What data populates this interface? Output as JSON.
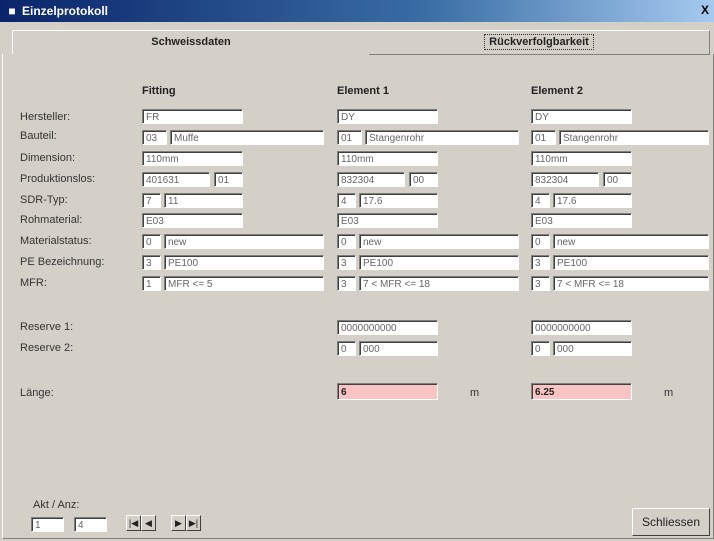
{
  "window": {
    "title": "Einzelprotokoll",
    "close_label": "X"
  },
  "tabs": [
    {
      "label": "Schweissdaten"
    },
    {
      "label": "Rückverfolgbarkeit"
    }
  ],
  "columns": {
    "fitting": "Fitting",
    "element1": "Element 1",
    "element2": "Element 2"
  },
  "labels": {
    "hersteller": "Hersteller:",
    "bauteil": "Bauteil:",
    "dimension": "Dimension:",
    "produktionslos": "Produktionslos:",
    "sdr_typ": "SDR-Typ:",
    "rohmaterial": "Rohmaterial:",
    "materialstatus": "Materialstatus:",
    "pe_bezeichnung": "PE Bezeichnung:",
    "mfr": "MFR:",
    "reserve1": "Reserve 1:",
    "reserve2": "Reserve 2:",
    "laenge": "Länge:"
  },
  "fitting": {
    "hersteller": "FR",
    "bauteil_code": "03",
    "bauteil_name": "Muffe",
    "dimension": "110mm",
    "prodlos1": "401631",
    "prodlos2": "01",
    "sdr1": "7",
    "sdr2": "11",
    "rohmaterial": "E03",
    "mat_code": "0",
    "mat_name": "new",
    "pe_code": "3",
    "pe_name": "PE100",
    "mfr_code": "1",
    "mfr_name": "MFR <= 5"
  },
  "element1": {
    "hersteller": "DY",
    "bauteil_code": "01",
    "bauteil_name": "Stangenrohr",
    "dimension": "110mm",
    "prodlos1": "832304",
    "prodlos2": "00",
    "sdr1": "4",
    "sdr2": "17.6",
    "rohmaterial": "E03",
    "mat_code": "0",
    "mat_name": "new",
    "pe_code": "3",
    "pe_name": "PE100",
    "mfr_code": "3",
    "mfr_name": "7 < MFR <= 18",
    "reserve1": "0000000000",
    "reserve2_code": "0",
    "reserve2_val": "000",
    "laenge": "6",
    "unit": "m"
  },
  "element2": {
    "hersteller": "DY",
    "bauteil_code": "01",
    "bauteil_name": "Stangenrohr",
    "dimension": "110mm",
    "prodlos1": "832304",
    "prodlos2": "00",
    "sdr1": "4",
    "sdr2": "17.6",
    "rohmaterial": "E03",
    "mat_code": "0",
    "mat_name": "new",
    "pe_code": "3",
    "pe_name": "PE100",
    "mfr_code": "3",
    "mfr_name": "7 < MFR <= 18",
    "reserve1": "0000000000",
    "reserve2_code": "0",
    "reserve2_val": "000",
    "laenge": "6.25",
    "unit": "m"
  },
  "footer": {
    "akt_anz_label": "Akt / Anz:",
    "akt_value": "1",
    "anz_value": "4",
    "nav": {
      "first": "|◀",
      "prev": "◀",
      "next": "▶",
      "last": "▶|"
    },
    "close_label": "Schliessen"
  }
}
